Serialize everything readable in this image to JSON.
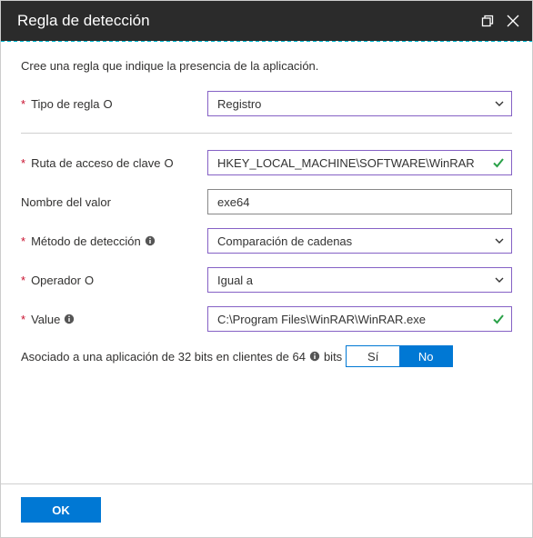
{
  "header": {
    "title": "Regla de detección"
  },
  "intro": "Cree una regla que indique la presencia de la aplicación.",
  "fields": {
    "rule_type": {
      "label": "Tipo de regla",
      "info_style": "circle",
      "required": true,
      "value": "Registro",
      "kind": "select"
    },
    "key_path": {
      "label": "Ruta de acceso de clave",
      "info_style": "circle",
      "required": true,
      "value": "HKEY_LOCAL_MACHINE\\SOFTWARE\\WinRAR",
      "kind": "validated"
    },
    "value_name": {
      "label": "Nombre del valor",
      "info_style": "none",
      "required": false,
      "value": "exe64",
      "kind": "plain"
    },
    "detection": {
      "label": "Método de detección",
      "info_style": "solid",
      "required": true,
      "value": "Comparación de cadenas",
      "kind": "select"
    },
    "operator": {
      "label": "Operador",
      "info_style": "circle",
      "required": true,
      "value": "Igual a",
      "kind": "select"
    },
    "value": {
      "label": "Value",
      "info_style": "solid",
      "required": true,
      "value": "C:\\Program Files\\WinRAR\\WinRAR.exe",
      "kind": "validated"
    }
  },
  "toggle": {
    "label_before": "Asociado a una aplicación de 32 bits en clientes de 64",
    "label_after": "bits",
    "yes": "Sí",
    "no": "No",
    "selected": "no"
  },
  "footer": {
    "ok": "OK"
  }
}
